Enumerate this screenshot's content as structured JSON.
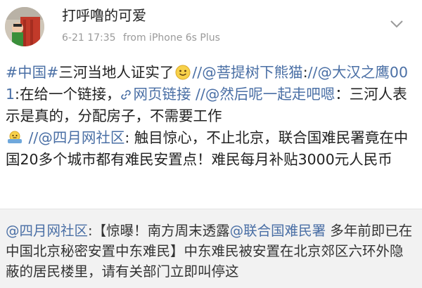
{
  "post": {
    "username": "打呼噜的可爱",
    "time": "6-21 17:35",
    "source": "from iPhone 6s Plus",
    "more_icon": "chevron-down-icon",
    "body": {
      "topic": "#中国#",
      "text1": "三河当地人证实了",
      "emoji1": "smile-emoji",
      "sep1": "//",
      "mention1": "@菩提树下熊猫",
      "text2": ":",
      "sep2": "//",
      "mention2": "@大汉之鹰001",
      "text3": ":在给一个链接，",
      "link_icon": "link-icon",
      "link_label": "网页链接",
      "sep3": " //",
      "mention3": "@然后呢一起走吧嗯",
      "text4": "：三河人表示是真的，分配房子，不需要工作",
      "emoji2": "shrug-emoji",
      "sep4": " //",
      "mention4": "@四月网社区",
      "text5": ": 触目惊心，不止北京，联合国难民署竟在中国20多个城市都有难民安置点！难民每月补贴3000元人民币"
    }
  },
  "retweet": {
    "mention1": "@四月网社区",
    "text1": ":【惊曝！南方周末透露",
    "mention2": "@联合国难民署",
    "text2": " 多年前即已在中国北京秘密安置中东难民】中东难民被安置在北京郊区六环外隐蔽的居民楼里，请有关部门立即叫停这"
  },
  "colors": {
    "link": "#4a6fa5",
    "text": "#222222",
    "meta": "#9a9a9a",
    "retweet_bg": "#f2f2f2"
  }
}
